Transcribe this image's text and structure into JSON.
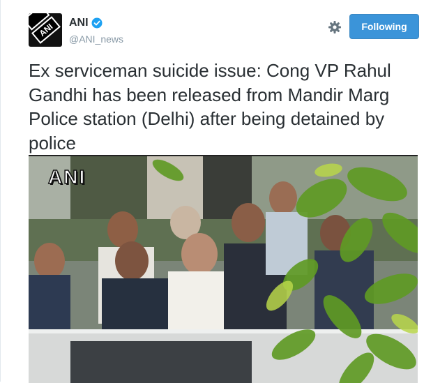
{
  "user": {
    "display_name": "ANI",
    "handle": "@ANI_news",
    "avatar_text": "ANI",
    "verified": true
  },
  "header": {
    "follow_label": "Following",
    "settings_icon": "gear-icon"
  },
  "tweet": {
    "text": "Ex serviceman suicide issue: Cong VP Rahul Gandhi has been released from Mandir Marg Police station (Delhi) after being detained by police"
  },
  "media": {
    "watermark": "ANI"
  },
  "colors": {
    "follow_button": "#3b94d9",
    "verified": "#1da1f2",
    "handle": "#8899a6",
    "text": "#292f33"
  }
}
